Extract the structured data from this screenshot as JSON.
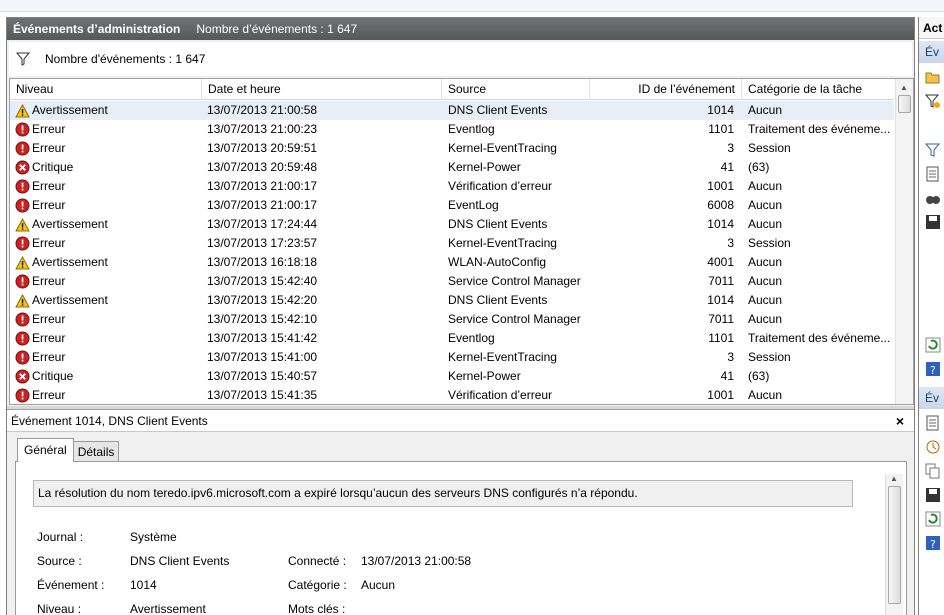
{
  "panel": {
    "title": "Événements d’administration",
    "count_label": "Nombre d’événements : 1 647"
  },
  "filter": {
    "icon": "filter-icon",
    "label": "Nombre d'événements : 1 647"
  },
  "table": {
    "columns": [
      "Niveau",
      "Date et heure",
      "Source",
      "ID de l’événement",
      "Catégorie de la tâche"
    ],
    "rows": [
      {
        "level": "Avertissement",
        "icon": "warning-icon",
        "date": "13/07/2013 21:00:58",
        "source": "DNS Client Events",
        "id": "1014",
        "category": "Aucun"
      },
      {
        "level": "Erreur",
        "icon": "error-icon",
        "date": "13/07/2013 21:00:23",
        "source": "Eventlog",
        "id": "1101",
        "category": "Traitement des événeme..."
      },
      {
        "level": "Erreur",
        "icon": "error-icon",
        "date": "13/07/2013 20:59:51",
        "source": "Kernel-EventTracing",
        "id": "3",
        "category": "Session"
      },
      {
        "level": "Critique",
        "icon": "critical-icon",
        "date": "13/07/2013 20:59:48",
        "source": "Kernel-Power",
        "id": "41",
        "category": "(63)"
      },
      {
        "level": "Erreur",
        "icon": "error-icon",
        "date": "13/07/2013 21:00:17",
        "source": "Vérification d’erreur",
        "id": "1001",
        "category": "Aucun"
      },
      {
        "level": "Erreur",
        "icon": "error-icon",
        "date": "13/07/2013 21:00:17",
        "source": "EventLog",
        "id": "6008",
        "category": "Aucun"
      },
      {
        "level": "Avertissement",
        "icon": "warning-icon",
        "date": "13/07/2013 17:24:44",
        "source": "DNS Client Events",
        "id": "1014",
        "category": "Aucun"
      },
      {
        "level": "Erreur",
        "icon": "error-icon",
        "date": "13/07/2013 17:23:57",
        "source": "Kernel-EventTracing",
        "id": "3",
        "category": "Session"
      },
      {
        "level": "Avertissement",
        "icon": "warning-icon",
        "date": "13/07/2013 16:18:18",
        "source": "WLAN-AutoConfig",
        "id": "4001",
        "category": "Aucun"
      },
      {
        "level": "Erreur",
        "icon": "error-icon",
        "date": "13/07/2013 15:42:40",
        "source": "Service Control Manager",
        "id": "7011",
        "category": "Aucun"
      },
      {
        "level": "Avertissement",
        "icon": "warning-icon",
        "date": "13/07/2013 15:42:20",
        "source": "DNS Client Events",
        "id": "1014",
        "category": "Aucun"
      },
      {
        "level": "Erreur",
        "icon": "error-icon",
        "date": "13/07/2013 15:42:10",
        "source": "Service Control Manager",
        "id": "7011",
        "category": "Aucun"
      },
      {
        "level": "Erreur",
        "icon": "error-icon",
        "date": "13/07/2013 15:41:42",
        "source": "Eventlog",
        "id": "1101",
        "category": "Traitement des événeme..."
      },
      {
        "level": "Erreur",
        "icon": "error-icon",
        "date": "13/07/2013 15:41:00",
        "source": "Kernel-EventTracing",
        "id": "3",
        "category": "Session"
      },
      {
        "level": "Critique",
        "icon": "critical-icon",
        "date": "13/07/2013 15:40:57",
        "source": "Kernel-Power",
        "id": "41",
        "category": "(63)"
      },
      {
        "level": "Erreur",
        "icon": "error-icon",
        "date": "13/07/2013 15:41:35",
        "source": "Vérification d’erreur",
        "id": "1001",
        "category": "Aucun"
      }
    ]
  },
  "details": {
    "header": "Événement 1014, DNS Client Events",
    "close": "×",
    "tabs": [
      "Général",
      "Détails"
    ],
    "message": "La résolution du nom teredo.ipv6.microsoft.com a expiré lorsqu’aucun des serveurs DNS configurés n’a répondu.",
    "fields": {
      "journal_label": "Journal :",
      "journal_value": "Système",
      "source_label": "Source :",
      "source_value": "DNS Client Events",
      "connecte_label": "Connecté :",
      "connecte_value": "13/07/2013 21:00:58",
      "evenement_label": "Événement :",
      "evenement_value": "1014",
      "categorie_label": "Catégorie :",
      "categorie_value": "Aucun",
      "niveau_label": "Niveau :",
      "niveau_value": "Avertissement",
      "motscles_label": "Mots clés :"
    }
  },
  "actions": {
    "title": "Act",
    "section1": "Év",
    "section2": "Év"
  },
  "colors": {
    "title_bar": "#5d6164",
    "selected_row": "#e8eef7",
    "warning": "#f5c518",
    "error": "#cc2222",
    "section": "#c8d6ea"
  }
}
